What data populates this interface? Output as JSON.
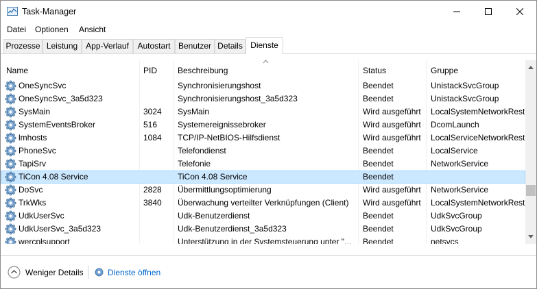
{
  "window": {
    "title": "Task-Manager"
  },
  "menu": [
    "Datei",
    "Optionen",
    "Ansicht"
  ],
  "tabs": [
    {
      "label": "Prozesse",
      "active": false
    },
    {
      "label": "Leistung",
      "active": false
    },
    {
      "label": "App-Verlauf",
      "active": false
    },
    {
      "label": "Autostart",
      "active": false
    },
    {
      "label": "Benutzer",
      "active": false
    },
    {
      "label": "Details",
      "active": false
    },
    {
      "label": "Dienste",
      "active": true
    }
  ],
  "columns": {
    "name": "Name",
    "pid": "PID",
    "description": "Beschreibung",
    "status": "Status",
    "group": "Gruppe"
  },
  "services": [
    {
      "name": "OneSyncSvc",
      "pid": "",
      "description": "Synchronisierungshost",
      "status": "Beendet",
      "group": "UnistackSvcGroup"
    },
    {
      "name": "OneSyncSvc_3a5d323",
      "pid": "",
      "description": "Synchronisierungshost_3a5d323",
      "status": "Beendet",
      "group": "UnistackSvcGroup"
    },
    {
      "name": "SysMain",
      "pid": "3024",
      "description": "SysMain",
      "status": "Wird ausgeführt",
      "group": "LocalSystemNetworkRestri"
    },
    {
      "name": "SystemEventsBroker",
      "pid": "516",
      "description": "Systemereignissebroker",
      "status": "Wird ausgeführt",
      "group": "DcomLaunch"
    },
    {
      "name": "lmhosts",
      "pid": "1084",
      "description": "TCP/IP-NetBIOS-Hilfsdienst",
      "status": "Wird ausgeführt",
      "group": "LocalServiceNetworkRestri"
    },
    {
      "name": "PhoneSvc",
      "pid": "",
      "description": "Telefondienst",
      "status": "Beendet",
      "group": "LocalService"
    },
    {
      "name": "TapiSrv",
      "pid": "",
      "description": "Telefonie",
      "status": "Beendet",
      "group": "NetworkService"
    },
    {
      "name": "TiCon 4.08 Service",
      "pid": "",
      "description": "TiCon 4.08 Service",
      "status": "Beendet",
      "group": "",
      "selected": true
    },
    {
      "name": "DoSvc",
      "pid": "2828",
      "description": "Übermittlungsoptimierung",
      "status": "Wird ausgeführt",
      "group": "NetworkService"
    },
    {
      "name": "TrkWks",
      "pid": "3840",
      "description": "Überwachung verteilter Verknüpfungen (Client)",
      "status": "Wird ausgeführt",
      "group": "LocalSystemNetworkRestri"
    },
    {
      "name": "UdkUserSvc",
      "pid": "",
      "description": "Udk-Benutzerdienst",
      "status": "Beendet",
      "group": "UdkSvcGroup"
    },
    {
      "name": "UdkUserSvc_3a5d323",
      "pid": "",
      "description": "Udk-Benutzerdienst_3a5d323",
      "status": "Beendet",
      "group": "UdkSvcGroup"
    },
    {
      "name": "wercplsupport",
      "pid": "",
      "description": "Unterstützung in der Systemsteuerung unter \"...",
      "status": "Beendet",
      "group": "netsvcs"
    }
  ],
  "footer": {
    "fewer_details": "Weniger Details",
    "open_services": "Dienste öffnen"
  },
  "colors": {
    "selection": "#cce8ff",
    "selection_border": "#99d1ff",
    "link": "#0066cc"
  }
}
